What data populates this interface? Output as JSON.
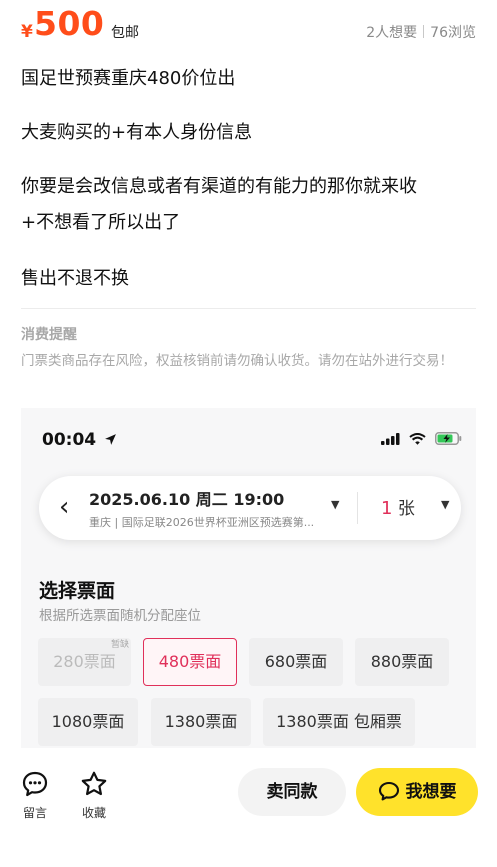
{
  "header": {
    "currency": "¥",
    "price": "500",
    "shipping": "包邮",
    "wants": "2人想要",
    "views": "76浏览"
  },
  "description": [
    "国足世预赛重庆480价位出",
    "大麦购买的+有本人身份信息",
    "你要是会改信息或者有渠道的有能力的那你就来收",
    "+不想看了所以出了",
    "售出不退不换"
  ],
  "notice": {
    "title": "消费提醒",
    "body": "门票类商品存在风险，权益核销前请勿确认收货。请勿在站外进行交易！"
  },
  "screenshot": {
    "status_time": "00:04",
    "date": "2025.06.10 周二 19:00",
    "venue": "重庆 | 国际足联2026世界杯亚洲区预选赛第...",
    "qty_num": "1",
    "qty_unit": "张",
    "section_title": "选择票面",
    "section_sub": "根据所选票面随机分配座位",
    "shortage_tag": "暂缺",
    "tiers": [
      "280票面",
      "480票面",
      "680票面",
      "880票面",
      "1080票面",
      "1380票面",
      "1380票面 包厢票"
    ],
    "selected_tier": "480票面",
    "colors": {
      "accent": "#e0305a"
    }
  },
  "bottom": {
    "comment_label": "留言",
    "favorite_label": "收藏",
    "same_label": "卖同款",
    "want_label": "我想要"
  },
  "colors": {
    "price": "#ff4d1a",
    "want_button": "#ffe22b"
  },
  "icons": [
    "location-arrow-icon",
    "signal-icon",
    "wifi-icon",
    "battery-charging-icon",
    "back-chevron-icon",
    "dropdown-caret-icon",
    "comment-icon",
    "star-icon",
    "chat-bubble-icon"
  ]
}
